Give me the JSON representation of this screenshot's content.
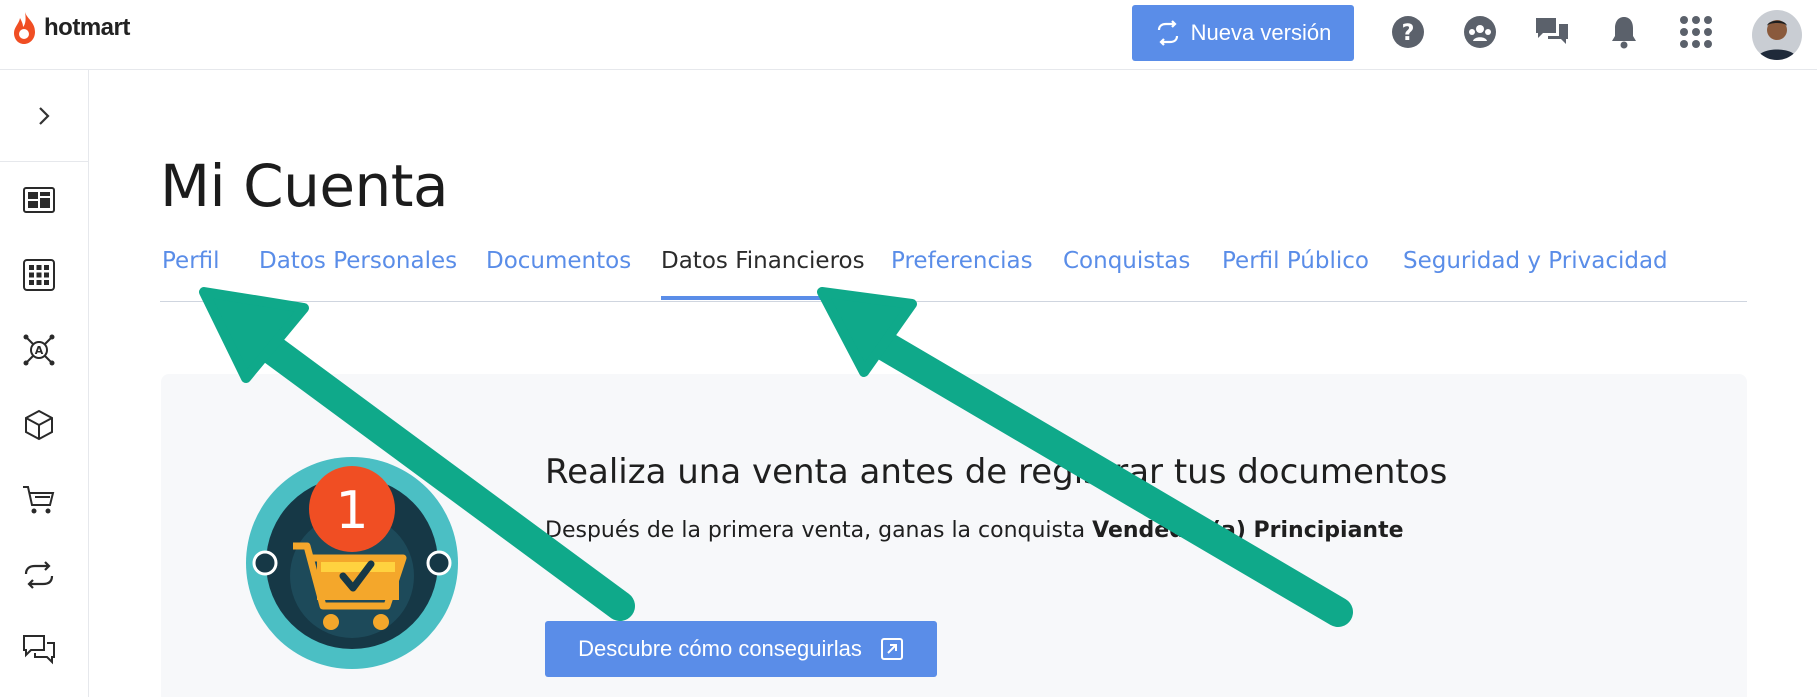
{
  "header": {
    "logo_text": "hotmart",
    "new_version_label": "Nueva versión"
  },
  "page": {
    "title": "Mi Cuenta"
  },
  "tabs": [
    {
      "label": "Perfil",
      "active": false
    },
    {
      "label": "Datos Personales",
      "active": false
    },
    {
      "label": "Documentos",
      "active": false
    },
    {
      "label": "Datos Financieros",
      "active": true
    },
    {
      "label": "Preferencias",
      "active": false
    },
    {
      "label": "Conquistas",
      "active": false
    },
    {
      "label": "Perfil Público",
      "active": false
    },
    {
      "label": "Seguridad y Privacidad",
      "active": false
    }
  ],
  "card": {
    "title": "Realiza una venta antes de registrar tus documentos",
    "desc_prefix": "Después de la primera venta, ganas la conquista ",
    "desc_bold": "Vendedor(a) Principiante",
    "cta_label": "Descubre cómo conseguirlas",
    "badge_number": "1"
  },
  "colors": {
    "accent": "#5a8de8",
    "annotation_arrow": "#0fa98a",
    "brand_flame": "#f04e23"
  },
  "icons": {
    "top": [
      "help-icon",
      "community-icon",
      "chat-icon",
      "bell-icon",
      "apps-grid-icon"
    ],
    "sidebar": [
      "dashboard-icon",
      "apps-icon",
      "affiliate-network-icon",
      "product-box-icon",
      "cart-icon",
      "refresh-icon",
      "messages-icon"
    ]
  }
}
